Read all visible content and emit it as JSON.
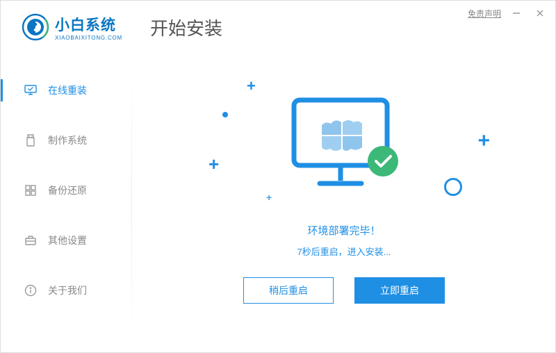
{
  "titlebar": {
    "disclaimer": "免责声明"
  },
  "logo": {
    "cn": "小白系统",
    "en": "XIAOBAIXITONG.COM"
  },
  "page_title": "开始安装",
  "sidebar": {
    "items": [
      {
        "label": "在线重装"
      },
      {
        "label": "制作系统"
      },
      {
        "label": "备份还原"
      },
      {
        "label": "其他设置"
      },
      {
        "label": "关于我们"
      }
    ]
  },
  "main": {
    "status_title": "环境部署完毕！",
    "status_sub": "7秒后重启，进入安装...",
    "btn_later": "稍后重启",
    "btn_now": "立即重启"
  },
  "colors": {
    "primary": "#1F8FE4",
    "green": "#3CB878"
  }
}
